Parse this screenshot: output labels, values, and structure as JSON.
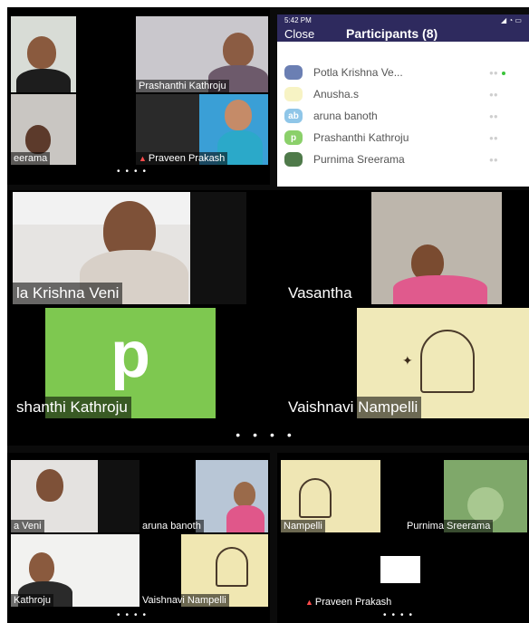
{
  "status_bar": {
    "time": "5:42 PM",
    "icons": "◢ ◔ ▭"
  },
  "participants_panel": {
    "close_label": "Close",
    "title": "Participants (8)",
    "header_color": "#2e2a5e",
    "items": [
      {
        "name": "Potla Krishna Ve...",
        "status": "●●"
      },
      {
        "name": "Anusha.s",
        "status": "●●"
      },
      {
        "name": "aruna banoth",
        "avatar_text": "ab",
        "status": "●●"
      },
      {
        "name": "Prashanthi Kathroju",
        "avatar_text": "p",
        "status": "●●"
      },
      {
        "name": "Purnima Sreerama",
        "status": "●●"
      }
    ]
  },
  "top_panel": {
    "tiles": [
      {
        "name": "Prashanthi Kathroju"
      },
      {
        "name": "eerama"
      },
      {
        "name": "Praveen Prakash"
      }
    ],
    "dots": "••••"
  },
  "middle_panel": {
    "tiles": [
      {
        "name": "la Krishna Veni"
      },
      {
        "name": "Vasantha"
      },
      {
        "name": "shanthi Kathroju",
        "avatar_letter": "p"
      },
      {
        "name": "Vaishnavi Nampelli"
      }
    ],
    "dots": "••••",
    "avatar_color": "#7ec850"
  },
  "bottom_left_panel": {
    "tiles": [
      {
        "name": "a Veni"
      },
      {
        "name": "aruna banoth"
      },
      {
        "name": "Kathroju"
      },
      {
        "name": "Vaishnavi Nampelli"
      }
    ],
    "dots": "••••"
  },
  "bottom_right_panel": {
    "tiles": [
      {
        "name": "Nampelli"
      },
      {
        "name": "Purnima Sreerama"
      },
      {
        "name": "Praveen Prakash"
      }
    ],
    "dots": "••••"
  }
}
